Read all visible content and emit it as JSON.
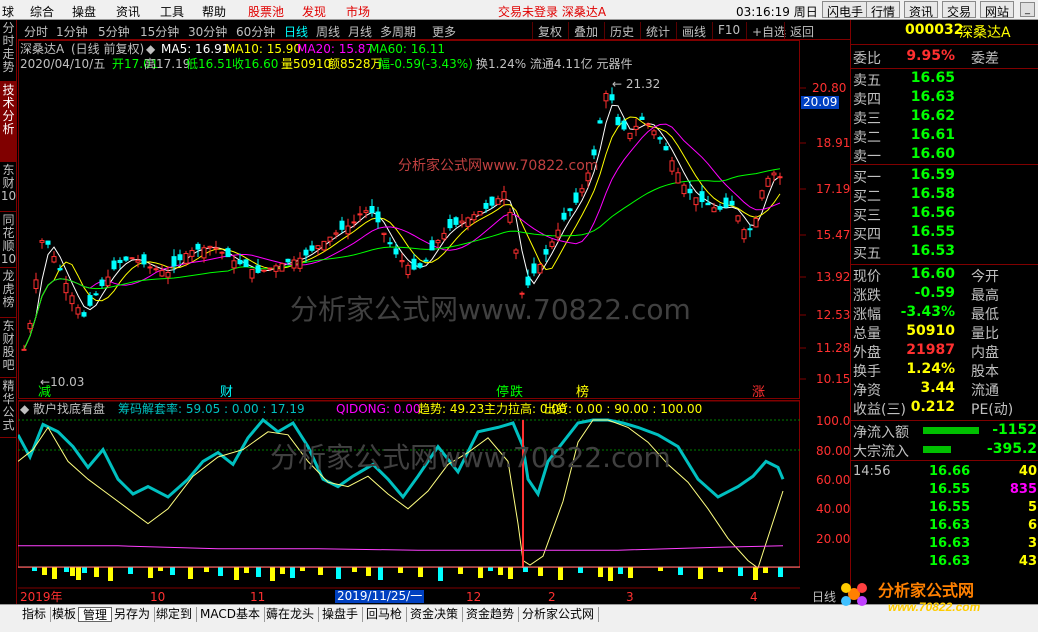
{
  "menu": {
    "left_items": [
      "球",
      "综合",
      "操盘",
      "资讯",
      "工具",
      "帮助",
      "股票池",
      "发现",
      "市场"
    ],
    "status": "交易未登录 深桑达A",
    "time": "03:16:19 周日",
    "buttons": [
      "闪电手",
      "行情",
      "资讯",
      "交易",
      "网站"
    ],
    "window_buttons": [
      "_",
      "□",
      "×"
    ]
  },
  "left_tabs": [
    "分时走势",
    "技术分析",
    "东财10",
    "同花顺10",
    "龙虎榜",
    "东财股吧",
    "精华公式"
  ],
  "periods": [
    "分时",
    "1分钟",
    "5分钟",
    "15分钟",
    "30分钟",
    "60分钟",
    "日线",
    "周线",
    "月线",
    "多周期",
    "更多"
  ],
  "active_period": "日线",
  "toolbar": [
    "复权",
    "叠加",
    "历史",
    "统计",
    "画线",
    "F10",
    "+自选",
    "返回"
  ],
  "stock": {
    "name": "深桑达A",
    "subtitle": "(日线 前复权)",
    "ma_labels": [
      "MA5: 16.91",
      "MA10: 15.90",
      "MA20: 15.87",
      "MA60: 16.11"
    ],
    "line2_date": "2020/04/10/五",
    "line2_open": "开17.01",
    "line2_high": "高17.19",
    "line2_low": "低16.51",
    "line2_close": "收16.60",
    "line2_vol": "量50910",
    "line2_amt": "额8528万",
    "line2_chg": "幅-0.59(-3.43%)",
    "line2_rest": "换1.24% 流通4.11亿 元器件"
  },
  "price_axis": [
    "20.80",
    "18.91",
    "17.19",
    "15.47",
    "13.92",
    "12.53",
    "11.28",
    "10.15"
  ],
  "price_cursor": "20.09",
  "chart_annotations": {
    "high": "21.32",
    "low": "10.03",
    "watermark": "分析家公式网www.70822.com",
    "watermark2": "分析家公式网www.70822.com",
    "events": [
      "减",
      "财",
      "停",
      "跌",
      "榜",
      "涨"
    ]
  },
  "indicator": {
    "title": "散户找底看盘",
    "params": "筹码解套率: 59.05 : 0.00 : 17.19",
    "qidong": "QIDONG: 0.00",
    "trend": "趋势: 49.23",
    "main": "主力拉高: 0.00",
    "out": "出货: 0.00 : 90.00 : 100.00",
    "axis": [
      "100.00",
      "80.00",
      "60.00",
      "40.00",
      "20.00"
    ]
  },
  "xaxis": {
    "labels": [
      "2019年",
      "10",
      "11",
      "12",
      "2019/11/25/一",
      "2",
      "3",
      "4"
    ],
    "period": "日线"
  },
  "bottom_tabs": [
    "指标",
    "模板",
    "管理",
    "另存为",
    "绑定到",
    "MACD基本",
    "薅在龙头",
    "操盘手",
    "回马枪",
    "资金决策",
    "资金趋势",
    "分析家公式网"
  ],
  "active_bottom_tab": "管理",
  "quote": {
    "code": "000032",
    "name": "深桑达A",
    "wei_bi_label": "委比",
    "wei_bi": "9.95%",
    "wei_cha_label": "委差",
    "sells": [
      {
        "label": "卖五",
        "price": "16.65"
      },
      {
        "label": "卖四",
        "price": "16.63"
      },
      {
        "label": "卖三",
        "price": "16.62"
      },
      {
        "label": "卖二",
        "price": "16.61"
      },
      {
        "label": "卖一",
        "price": "16.60"
      }
    ],
    "buys": [
      {
        "label": "买一",
        "price": "16.59"
      },
      {
        "label": "买二",
        "price": "16.58"
      },
      {
        "label": "买三",
        "price": "16.56"
      },
      {
        "label": "买四",
        "price": "16.55"
      },
      {
        "label": "买五",
        "price": "16.53"
      }
    ],
    "stats": [
      {
        "label": "现价",
        "value": "16.60",
        "label2": "今开",
        "color": "#00ff00"
      },
      {
        "label": "涨跌",
        "value": "-0.59",
        "label2": "最高",
        "color": "#00ff00"
      },
      {
        "label": "涨幅",
        "value": "-3.43%",
        "label2": "最低",
        "color": "#00ff00"
      },
      {
        "label": "总量",
        "value": "50910",
        "label2": "量比",
        "color": "#ffff00"
      },
      {
        "label": "外盘",
        "value": "21987",
        "label2": "内盘",
        "color": "#ff3030"
      },
      {
        "label": "换手",
        "value": "1.24%",
        "label2": "股本",
        "color": "#ffff00"
      },
      {
        "label": "净资",
        "value": "3.44",
        "label2": "流通",
        "color": "#ffff00"
      },
      {
        "label": "收益(三)",
        "value": "0.212",
        "label2": "PE(动)",
        "color": "#ffff00"
      }
    ],
    "flow": [
      {
        "label": "净流入额",
        "value": "-1152"
      },
      {
        "label": "大宗流入",
        "value": "-395.2"
      }
    ],
    "ticks": [
      {
        "time": "14:56",
        "price": "16.66",
        "vol": "40",
        "vcolor": "#ffff00"
      },
      {
        "time": "",
        "price": "16.55",
        "vol": "835",
        "vcolor": "#ff00ff"
      },
      {
        "time": "",
        "price": "16.55",
        "vol": "5",
        "vcolor": "#ffff00"
      },
      {
        "time": "",
        "price": "16.63",
        "vol": "6",
        "vcolor": "#ffff00"
      },
      {
        "time": "",
        "price": "16.63",
        "vol": "3",
        "vcolor": "#ffff00"
      },
      {
        "time": "",
        "price": "16.63",
        "vol": "43",
        "vcolor": "#ffff00"
      }
    ],
    "logo_text": "分析家公式网",
    "logo_url": "www.70822.com"
  },
  "colors": {
    "up": "#ff3030",
    "down": "#00ffff",
    "ma5": "#ffffff",
    "ma10": "#ffff00",
    "ma20": "#ff00ff",
    "ma60": "#00ff00",
    "border": "#800000"
  }
}
